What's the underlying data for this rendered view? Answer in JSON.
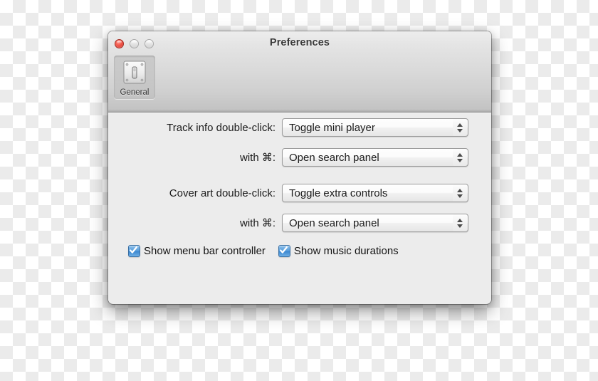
{
  "window": {
    "title": "Preferences",
    "traffic_lights": [
      {
        "name": "close",
        "color": "#f2564a",
        "enabled": true
      },
      {
        "name": "minimize",
        "color": "#d5d5d5",
        "enabled": false
      },
      {
        "name": "zoom",
        "color": "#d5d5d5",
        "enabled": false
      }
    ]
  },
  "toolbar": {
    "items": [
      {
        "label": "General",
        "icon": "light-switch-icon",
        "selected": true
      }
    ]
  },
  "form": {
    "rows": [
      {
        "label": "Track info double-click:",
        "value": "Toggle mini player"
      },
      {
        "label": "with ⌘:",
        "value": "Open search panel"
      },
      {
        "label": "Cover art double-click:",
        "value": "Toggle extra controls"
      },
      {
        "label": "with ⌘:",
        "value": "Open search panel"
      }
    ],
    "checkboxes": [
      {
        "label": "Show menu bar controller",
        "checked": true
      },
      {
        "label": "Show music durations",
        "checked": true
      }
    ]
  },
  "colors": {
    "checkbox_accent": "#3d88d0",
    "close_button": "#f2564a",
    "content_bg": "#ececec",
    "title_text": "#3a3a3a"
  }
}
